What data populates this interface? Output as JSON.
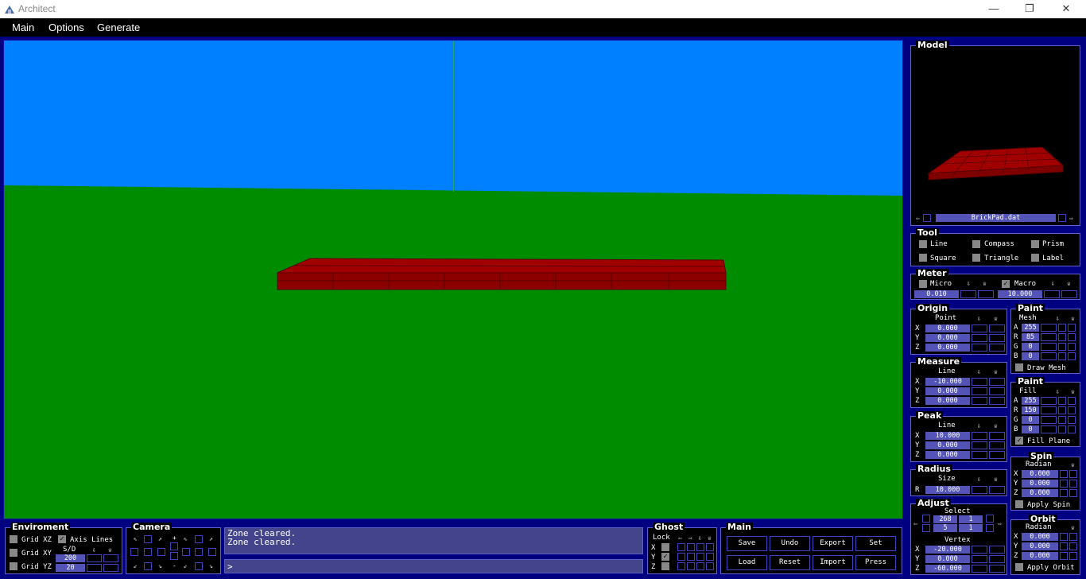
{
  "window": {
    "title": "Architect",
    "minimize": "—",
    "restore": "❐",
    "close": "✕"
  },
  "menubar": [
    "Main",
    "Options",
    "Generate"
  ],
  "colors": {
    "sky": "#0080ff",
    "grass": "#008c00",
    "brick": "#8c0000",
    "panel": "#000080",
    "field": "#5454b8"
  },
  "model": {
    "label": "Model",
    "file": "BrickPad.dat",
    "prev": "⇦",
    "next": "⇨"
  },
  "tool": {
    "label": "Tool",
    "items": [
      "Line",
      "Compass",
      "Prism",
      "Square",
      "Triangle",
      "Label"
    ]
  },
  "meter": {
    "label": "Meter",
    "micro_label": "Micro",
    "micro_value": "0.010",
    "macro_label": "Macro",
    "macro_value": "10.000"
  },
  "origin": {
    "label": "Origin",
    "sub": "Point",
    "x": "0.000",
    "y": "0.000",
    "z": "0.000"
  },
  "measure": {
    "label": "Measure",
    "sub": "Line",
    "x": "-10.000",
    "y": "0.000",
    "z": "0.000"
  },
  "peak": {
    "label": "Peak",
    "sub": "Line",
    "x": "10.000",
    "y": "0.000",
    "z": "0.000"
  },
  "radius": {
    "label": "Radius",
    "sub": "Size",
    "r": "10.000"
  },
  "adjust": {
    "label": "Adjust",
    "select": "Select",
    "s1": "268",
    "s2": "1",
    "s3": "5",
    "s4": "1",
    "vertex": "Vertex",
    "x": "-20.000",
    "y": "0.000",
    "z": "-60.000"
  },
  "paint_mesh": {
    "label": "Paint",
    "sub": "Mesh",
    "a": "255",
    "r": "85",
    "g": "0",
    "b": "0",
    "check": "Draw Mesh"
  },
  "paint_fill": {
    "label": "Paint",
    "sub": "Fill",
    "a": "255",
    "r": "150",
    "g": "0",
    "b": "0",
    "check": "Fill Plane"
  },
  "spin": {
    "label": "Spin",
    "sub": "Radian",
    "x": "0.000",
    "y": "0.000",
    "z": "0.000",
    "check": "Apply Spin"
  },
  "orbit": {
    "label": "Orbit",
    "sub": "Radian",
    "x": "0.000",
    "y": "0.000",
    "z": "0.000",
    "check": "Apply Orbit"
  },
  "axes": {
    "x": "X",
    "y": "Y",
    "z": "Z",
    "r": "R",
    "a": "A",
    "rr": "R",
    "g": "G",
    "b": "B"
  },
  "icons": {
    "pin": "⇩",
    "trash": "♕",
    "check": "✓"
  },
  "environment": {
    "label": "Enviroment",
    "grid_xz": "Grid XZ",
    "axis_lines": "Axis Lines",
    "grid_xy": "Grid XY",
    "sd": "S/D",
    "sd_value": "200",
    "grid_yz": "Grid YZ",
    "yz_value": "20"
  },
  "camera": {
    "label": "Camera"
  },
  "console": {
    "line1": "Zone cleared.",
    "line2": "Zone cleared.",
    "prompt": ">"
  },
  "ghost": {
    "label": "Ghost",
    "lock": "Lock"
  },
  "main_panel": {
    "label": "Main",
    "buttons": [
      "Save",
      "Undo",
      "Export",
      "Set",
      "Load",
      "Reset",
      "Import",
      "Press"
    ]
  }
}
